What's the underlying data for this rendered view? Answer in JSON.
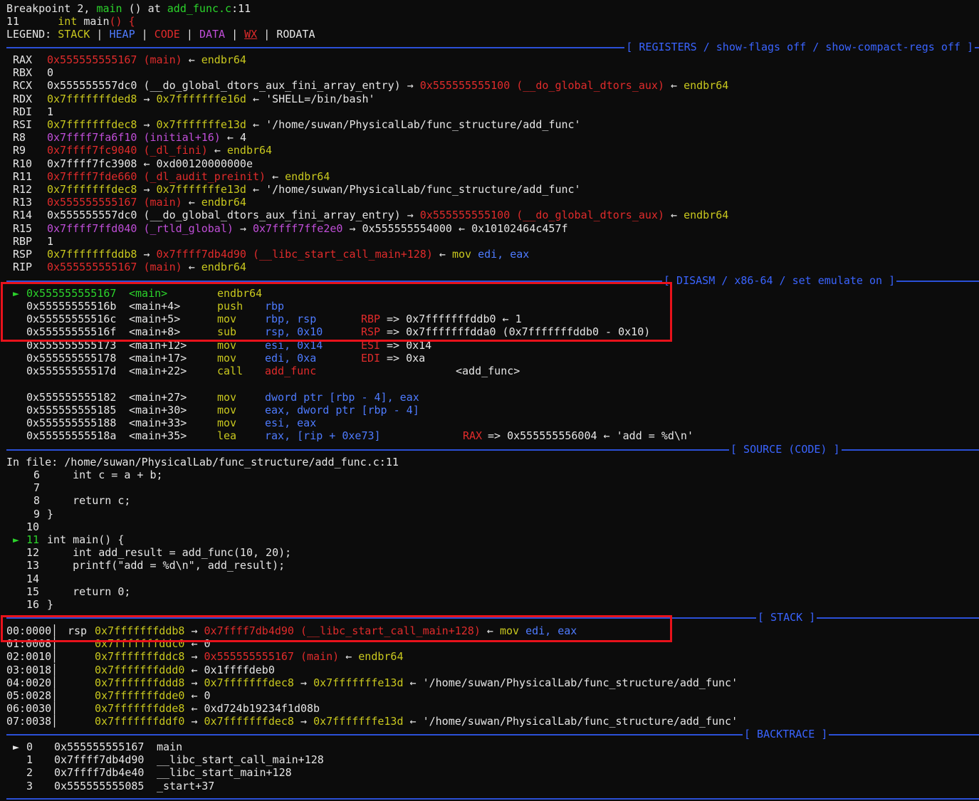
{
  "header": {
    "breakpoint_line": "Breakpoint 2, main () at add_func.c:11",
    "breakpoint_prefix": "Breakpoint 2, ",
    "breakpoint_func": "main",
    "breakpoint_mid": " () at ",
    "breakpoint_file": "add_func.c",
    "breakpoint_lineno": ":11",
    "source_no": "11",
    "source_kw": "int",
    "source_name": "main",
    "source_paren": "()",
    "source_brace": "{",
    "legend_label": "LEGEND:",
    "legend": {
      "stack": "STACK",
      "heap": "HEAP",
      "code": "CODE",
      "data": "DATA",
      "wx": "WX",
      "rodata": "RODATA"
    }
  },
  "sections": {
    "registers": "[ REGISTERS / show-flags off / show-compact-regs off ]",
    "disasm": "[ DISASM / x86-64 / set emulate on ]",
    "source": "[ SOURCE (CODE) ]",
    "stack": "[ STACK ]",
    "backtrace": "[ BACKTRACE ]"
  },
  "registers": [
    {
      "name": "RAX",
      "v1": "0x555555555167",
      "v2": "(main)",
      "arrow": "←",
      "v3": "endbr64"
    },
    {
      "name": "RBX",
      "v1": "0"
    },
    {
      "name": "RCX",
      "v1": "0x555555557dc0",
      "v2": "(__do_global_dtors_aux_fini_array_entry)",
      "arrow": "→",
      "v3": "0x555555555100",
      "v4": "(__do_global_dtors_aux)",
      "arrow2": "←",
      "v5": "endbr64"
    },
    {
      "name": "RDX",
      "v1": "0x7fffffffded8",
      "arrow": "→",
      "v3": "0x7fffffffe16d",
      "arrow2": "←",
      "v5": "'SHELL=/bin/bash'"
    },
    {
      "name": "RDI",
      "v1": "1"
    },
    {
      "name": "RSI",
      "v1": "0x7fffffffdec8",
      "arrow": "→",
      "v3": "0x7fffffffe13d",
      "arrow2": "←",
      "v5": "'/home/suwan/PhysicalLab/func_structure/add_func'"
    },
    {
      "name": "R8",
      "v1": "0x7ffff7fa6f10",
      "v2": "(initial+16)",
      "arrow": "←",
      "v3": "4"
    },
    {
      "name": "R9",
      "v1": "0x7ffff7fc9040",
      "v2": "(_dl_fini)",
      "arrow": "←",
      "v3": "endbr64"
    },
    {
      "name": "R10",
      "v1": "0x7ffff7fc3908",
      "arrow": "←",
      "v3": "0xd00120000000e"
    },
    {
      "name": "R11",
      "v1": "0x7ffff7fde660",
      "v2": "(_dl_audit_preinit)",
      "arrow": "←",
      "v3": "endbr64"
    },
    {
      "name": "R12",
      "v1": "0x7fffffffdec8",
      "arrow": "→",
      "v3": "0x7fffffffe13d",
      "arrow2": "←",
      "v5": "'/home/suwan/PhysicalLab/func_structure/add_func'"
    },
    {
      "name": "R13",
      "v1": "0x555555555167",
      "v2": "(main)",
      "arrow": "←",
      "v3": "endbr64"
    },
    {
      "name": "R14",
      "v1": "0x555555557dc0",
      "v2": "(__do_global_dtors_aux_fini_array_entry)",
      "arrow": "→",
      "v3": "0x555555555100",
      "v4": "(__do_global_dtors_aux)",
      "arrow2": "←",
      "v5": "endbr64"
    },
    {
      "name": "R15",
      "v1": "0x7ffff7ffd040",
      "v2": "(_rtld_global)",
      "arrow": "→",
      "v3": "0x7ffff7ffe2e0",
      "arrow2": "→",
      "v5": "0x555555554000",
      "arrow3": "←",
      "v6": "0x10102464c457f"
    },
    {
      "name": "RBP",
      "v1": "1"
    },
    {
      "name": "RSP",
      "v1": "0x7fffffffddb8",
      "arrow": "→",
      "v3": "0x7ffff7db4d90",
      "v4": "(__libc_start_call_main+128)",
      "arrow2": "←",
      "v5": "mov",
      "v6": "edi,",
      "v7": "eax"
    },
    {
      "name": "RIP",
      "v1": "0x555555555167",
      "v2": "(main)",
      "arrow": "←",
      "v3": "endbr64"
    }
  ],
  "disasm": [
    {
      "marker": "►",
      "addr": "0x555555555167",
      "sym": "<main>",
      "op": "endbr64",
      "args": "",
      "note": ""
    },
    {
      "addr": "0x55555555516b",
      "sym": "<main+4>",
      "op": "push",
      "args": "rbp"
    },
    {
      "addr": "0x55555555516c",
      "sym": "<main+5>",
      "op": "mov",
      "args": "rbp, rsp",
      "note_reg": "RBP",
      "note": "=> 0x7fffffffddb0 ← 1"
    },
    {
      "addr": "0x55555555516f",
      "sym": "<main+8>",
      "op": "sub",
      "args": "rsp, 0x10",
      "note_reg": "RSP",
      "note": "=> 0x7fffffffdda0 (0x7fffffffddb0 - 0x10)"
    },
    {
      "addr": "0x555555555173",
      "sym": "<main+12>",
      "op": "mov",
      "args": "esi, 0x14",
      "note_reg": "ESI",
      "note": "=> 0x14"
    },
    {
      "addr": "0x555555555178",
      "sym": "<main+17>",
      "op": "mov",
      "args": "edi, 0xa",
      "note_reg": "EDI",
      "note": "=> 0xa"
    },
    {
      "addr": "0x55555555517d",
      "sym": "<main+22>",
      "op": "call",
      "args": "add_func",
      "note": "<add_func>"
    },
    {
      "addr": "0x555555555182",
      "sym": "<main+27>",
      "op": "mov",
      "args": "dword ptr [rbp - 4], eax"
    },
    {
      "addr": "0x555555555185",
      "sym": "<main+30>",
      "op": "mov",
      "args": "eax, dword ptr [rbp - 4]"
    },
    {
      "addr": "0x555555555188",
      "sym": "<main+33>",
      "op": "mov",
      "args": "esi, eax"
    },
    {
      "addr": "0x55555555518a",
      "sym": "<main+35>",
      "op": "lea",
      "args": "rax, [rip + 0xe73]",
      "note_reg": "RAX",
      "note": "=> 0x555555556004 ← 'add = %d\\n'"
    }
  ],
  "source": {
    "file_label": "In file:",
    "file_path": "/home/suwan/PhysicalLab/func_structure/add_func.c:11",
    "lines": [
      {
        "no": "6",
        "code": "    int c = a + b;"
      },
      {
        "no": "7",
        "code": ""
      },
      {
        "no": "8",
        "code": "    return c;"
      },
      {
        "no": "9",
        "code": "}"
      },
      {
        "no": "10",
        "code": ""
      },
      {
        "no": "11",
        "code": "int main() {",
        "current": true,
        "marker": "►"
      },
      {
        "no": "12",
        "code": "    int add_result = add_func(10, 20);"
      },
      {
        "no": "13",
        "code": "    printf(\"add = %d\\n\", add_result);"
      },
      {
        "no": "14",
        "code": ""
      },
      {
        "no": "15",
        "code": "    return 0;"
      },
      {
        "no": "16",
        "code": "}"
      }
    ]
  },
  "stack": [
    {
      "idx": "00:0000",
      "reg": "rsp",
      "addr": "0x7fffffffddb8",
      "arrow": "→",
      "val": "0x7ffff7db4d90",
      "sym": "(__libc_start_call_main+128)",
      "arrow2": "←",
      "tail1": "mov",
      "tail2": "edi,",
      "tail3": "eax"
    },
    {
      "idx": "01:0008",
      "addr": "0x7fffffffddc0",
      "arrow": "←",
      "val": "0"
    },
    {
      "idx": "02:0010",
      "addr": "0x7fffffffddc8",
      "arrow": "→",
      "val": "0x555555555167",
      "sym": "(main)",
      "arrow2": "←",
      "tail1": "endbr64"
    },
    {
      "idx": "03:0018",
      "addr": "0x7fffffffddd0",
      "arrow": "←",
      "val": "0x1ffffdeb0"
    },
    {
      "idx": "04:0020",
      "addr": "0x7fffffffddd8",
      "arrow": "→",
      "val": "0x7fffffffdec8",
      "arrow2": "→",
      "val2": "0x7fffffffe13d",
      "arrow3": "←",
      "tail1": "'/home/suwan/PhysicalLab/func_structure/add_func'"
    },
    {
      "idx": "05:0028",
      "addr": "0x7fffffffdde0",
      "arrow": "←",
      "val": "0"
    },
    {
      "idx": "06:0030",
      "addr": "0x7fffffffdde8",
      "arrow": "←",
      "val": "0xd724b19234f1d08b"
    },
    {
      "idx": "07:0038",
      "addr": "0x7fffffffddf0",
      "arrow": "→",
      "val": "0x7fffffffdec8",
      "arrow2": "→",
      "val2": "0x7fffffffe13d",
      "arrow3": "←",
      "tail1": "'/home/suwan/PhysicalLab/func_structure/add_func'"
    }
  ],
  "backtrace": [
    {
      "marker": "►",
      "no": "0",
      "addr": "0x555555555167",
      "sym": "main"
    },
    {
      "no": "1",
      "addr": "0x7ffff7db4d90",
      "sym": "__libc_start_call_main+128"
    },
    {
      "no": "2",
      "addr": "0x7ffff7db4e40",
      "sym": "__libc_start_main+128"
    },
    {
      "no": "3",
      "addr": "0x555555555085",
      "sym": "_start+37"
    }
  ],
  "colors": {
    "background": "#0c0c0c",
    "separator": "#2b50d8",
    "highlight": "#e8121b"
  }
}
